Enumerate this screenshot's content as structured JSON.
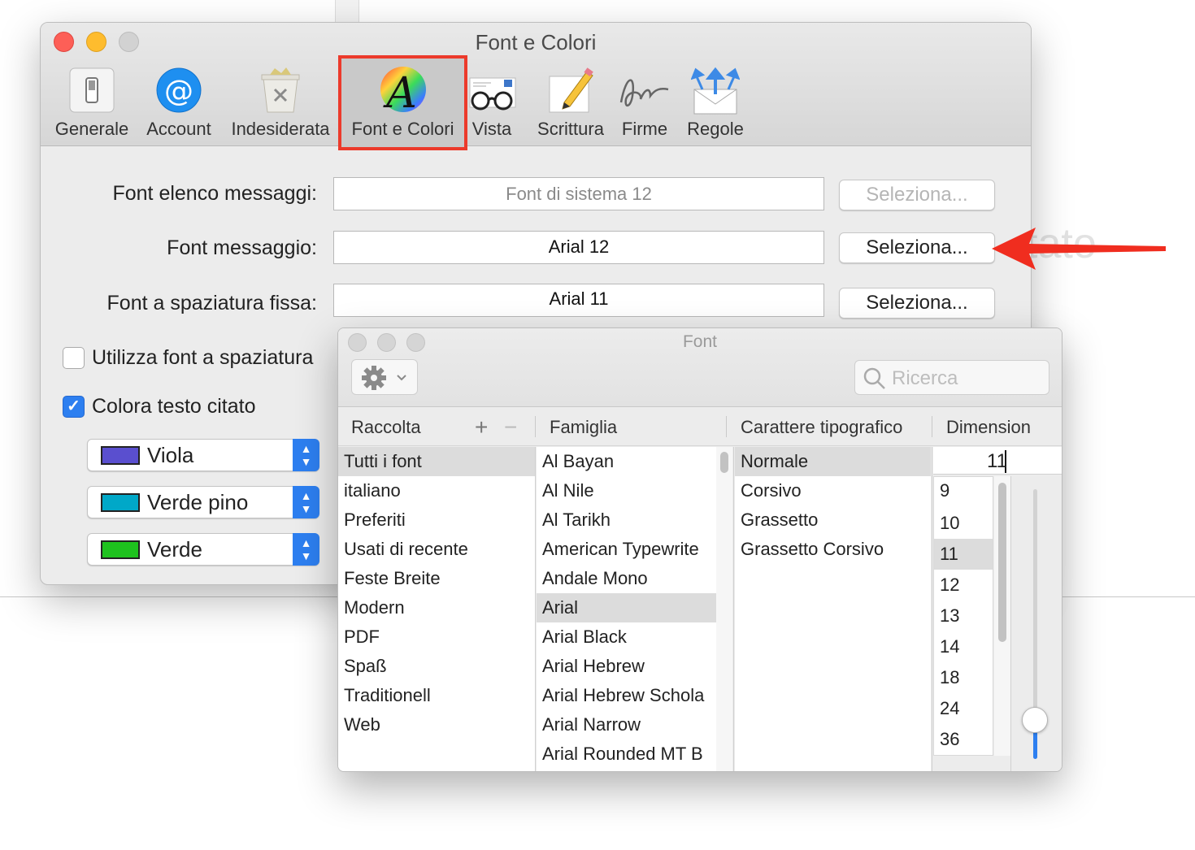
{
  "background": {
    "ghost_text": "tato"
  },
  "prefs": {
    "title": "Font e Colori",
    "toolbar": [
      {
        "label": "Generale",
        "icon": "switch-icon"
      },
      {
        "label": "Account",
        "icon": "at-icon"
      },
      {
        "label": "Indesiderata",
        "icon": "junk-icon"
      },
      {
        "label": "Font e Colori",
        "icon": "font-colors-icon",
        "selected": true
      },
      {
        "label": "Vista",
        "icon": "glasses-icon"
      },
      {
        "label": "Scrittura",
        "icon": "pencil-icon"
      },
      {
        "label": "Firme",
        "icon": "signature-icon"
      },
      {
        "label": "Regole",
        "icon": "rules-icon"
      }
    ],
    "fields": [
      {
        "label": "Font elenco messaggi:",
        "value": "Font di sistema 12",
        "button": "Seleziona...",
        "disabled": true
      },
      {
        "label": "Font messaggio:",
        "value": "Arial 12",
        "button": "Seleziona...",
        "disabled": false
      },
      {
        "label": "Font a spaziatura fissa:",
        "value": "Arial 11",
        "button": "Seleziona...",
        "disabled": false
      }
    ],
    "checkbox_fixed": {
      "label": "Utilizza font a spaziatura",
      "checked": false
    },
    "checkbox_quoted": {
      "label": "Colora testo citato",
      "checked": true
    },
    "quote_colors": [
      {
        "label": "Viola",
        "color": "#5a4fcf"
      },
      {
        "label": "Verde pino",
        "color": "#00a8c8"
      },
      {
        "label": "Verde",
        "color": "#1ec21e"
      }
    ]
  },
  "font_panel": {
    "title": "Font",
    "search_placeholder": "Ricerca",
    "headers": {
      "collection": "Raccolta",
      "family": "Famiglia",
      "typeface": "Carattere tipografico",
      "size": "Dimension"
    },
    "collections": [
      "Tutti i font",
      "italiano",
      "Preferiti",
      "Usati di recente",
      "Feste Breite",
      "Modern",
      "PDF",
      "Spaß",
      "Traditionell",
      "Web"
    ],
    "families": [
      "Al Bayan",
      "Al Nile",
      "Al Tarikh",
      "American Typewrite",
      "Andale Mono",
      "Arial",
      "Arial Black",
      "Arial Hebrew",
      "Arial Hebrew Schola",
      "Arial Narrow",
      "Arial Rounded MT B"
    ],
    "typefaces": [
      "Normale",
      "Corsivo",
      "Grassetto",
      "Grassetto Corsivo"
    ],
    "size_value": "11",
    "sizes": [
      "9",
      "10",
      "11",
      "12",
      "13",
      "14",
      "18",
      "24",
      "36"
    ],
    "selected_collection": "Tutti i font",
    "selected_family": "Arial",
    "selected_typeface": "Normale",
    "selected_size": "11"
  }
}
